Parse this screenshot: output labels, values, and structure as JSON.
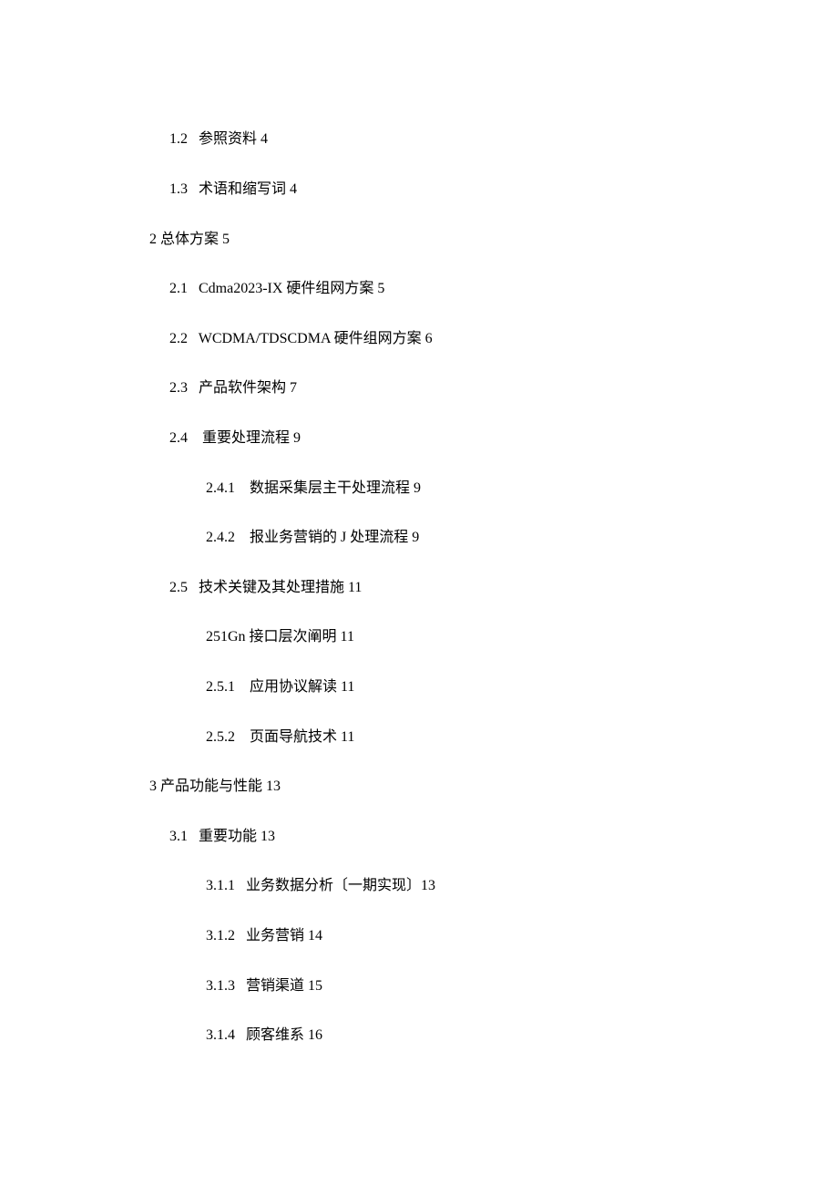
{
  "toc": {
    "level1": [
      {
        "num": "1.2",
        "title": "参照资料",
        "page": "4"
      },
      {
        "num": "1.3",
        "title": "术语和缩写词",
        "page": "4"
      }
    ],
    "section2": {
      "num": "2",
      "title": "总体方案",
      "page": "5",
      "children": [
        {
          "num": "2.1",
          "title": "Cdma2023-IX 硬件组网方案",
          "page": "5"
        },
        {
          "num": "2.2",
          "title": "WCDMA/TDSCDMA 硬件组网方案",
          "page": "6"
        },
        {
          "num": "2.3",
          "title": "产品软件架构",
          "page": "7"
        },
        {
          "num": "2.4",
          "title": "重要处理流程",
          "page": "9",
          "children": [
            {
              "num": "2.4.1",
              "title": "数据采集层主干处理流程",
              "page": "9"
            },
            {
              "num": "2.4.2",
              "title": "报业务营销的 J 处理流程",
              "page": "9"
            }
          ]
        },
        {
          "num": "2.5",
          "title": "技术关键及其处理措施",
          "page": "11",
          "children": [
            {
              "num": "251Gn",
              "title": "接口层次阐明",
              "page": "11"
            },
            {
              "num": "2.5.1",
              "title": "应用协议解读",
              "page": "11"
            },
            {
              "num": "2.5.2",
              "title": "页面导航技术",
              "page": "11"
            }
          ]
        }
      ]
    },
    "section3": {
      "num": "3",
      "title": "产品功能与性能",
      "page": "13",
      "children": [
        {
          "num": "3.1",
          "title": "重要功能",
          "page": "13",
          "children": [
            {
              "num": "3.1.1",
              "title": "业务数据分析〔一期实现〕",
              "page": "13"
            },
            {
              "num": "3.1.2",
              "title": "业务营销",
              "page": "14"
            },
            {
              "num": "3.1.3",
              "title": "营销渠道",
              "page": "15"
            },
            {
              "num": "3.1.4",
              "title": "顾客维系",
              "page": "16"
            }
          ]
        }
      ]
    }
  },
  "render": {
    "l0": "1.2   参照资料 4",
    "l1": "1.3   术语和缩写词 4",
    "l2": "2 总体方案 5",
    "l3": "2.1   Cdma2023-IX 硬件组网方案 5",
    "l4": "2.2   WCDMA/TDSCDMA 硬件组网方案 6",
    "l5": "2.3   产品软件架构 7",
    "l6": "2.4    重要处理流程 9",
    "l7": "2.4.1    数据采集层主干处理流程 9",
    "l8": "2.4.2    报业务营销的 J 处理流程 9",
    "l9": "2.5   技术关键及其处理措施 11",
    "l10": "251Gn 接口层次阐明 11",
    "l11": "2.5.1    应用协议解读 11",
    "l12": "2.5.2    页面导航技术 11",
    "l13": "3 产品功能与性能 13",
    "l14": "3.1   重要功能 13",
    "l15": "3.1.1   业务数据分析〔一期实现〕13",
    "l16": "3.1.2   业务营销 14",
    "l17": "3.1.3   营销渠道 15",
    "l18": "3.1.4   顾客维系 16"
  }
}
